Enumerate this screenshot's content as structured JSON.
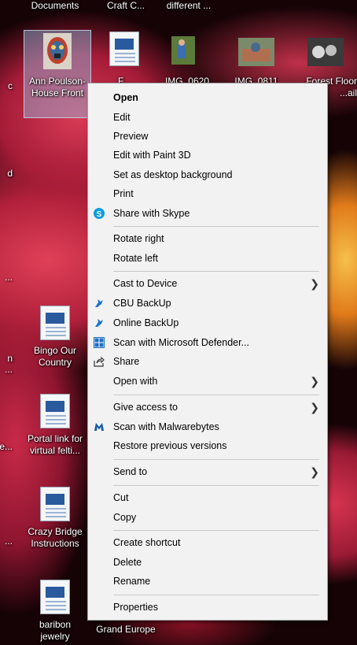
{
  "desktop": {
    "top_labels": [
      "Documents",
      "Craft C...",
      "different ..."
    ],
    "row1": [
      {
        "label": "Ann Poulson-House Front",
        "kind": "image",
        "selected": true
      },
      {
        "label": "F...",
        "kind": "document"
      },
      {
        "label": "IMG_0620",
        "kind": "photo"
      },
      {
        "label": "IMG_0811",
        "kind": "photo"
      },
      {
        "label": "Forest Floor ...ail",
        "kind": "photo"
      }
    ],
    "column_items": [
      {
        "label": "Bingo Our Country",
        "kind": "document"
      },
      {
        "label": "Portal link for virtual felti...",
        "kind": "document"
      },
      {
        "label": "Crazy Bridge Instructions",
        "kind": "document"
      },
      {
        "label": "baribon jewelry",
        "kind": "document"
      }
    ],
    "bottom_label": "Grand Europe",
    "edge_fragments": [
      "c",
      "d",
      "...",
      "n",
      "...",
      "e...",
      "..."
    ]
  },
  "context_menu": {
    "items": [
      {
        "label": "Open",
        "bold": true,
        "icon": null,
        "submenu": false
      },
      {
        "label": "Edit",
        "icon": null,
        "submenu": false
      },
      {
        "label": "Preview",
        "icon": null,
        "submenu": false
      },
      {
        "label": "Edit with Paint 3D",
        "icon": null,
        "submenu": false
      },
      {
        "label": "Set as desktop background",
        "icon": null,
        "submenu": false
      },
      {
        "label": "Print",
        "icon": null,
        "submenu": false
      },
      {
        "label": "Share with Skype",
        "icon": "skype-icon",
        "submenu": false
      },
      {
        "label": "Rotate right",
        "icon": null,
        "submenu": false
      },
      {
        "label": "Rotate left",
        "icon": null,
        "submenu": false
      },
      {
        "label": "Cast to Device",
        "icon": null,
        "submenu": true
      },
      {
        "label": "CBU BackUp",
        "icon": "backup-icon",
        "submenu": false
      },
      {
        "label": "Online BackUp",
        "icon": "backup-icon",
        "submenu": false
      },
      {
        "label": "Scan with Microsoft Defender...",
        "icon": "defender-icon",
        "submenu": false
      },
      {
        "label": "Share",
        "icon": "share-icon",
        "submenu": false
      },
      {
        "label": "Open with",
        "icon": null,
        "submenu": true
      },
      {
        "label": "Give access to",
        "icon": null,
        "submenu": true
      },
      {
        "label": "Scan with Malwarebytes",
        "icon": "malwarebytes-icon",
        "submenu": false
      },
      {
        "label": "Restore previous versions",
        "icon": null,
        "submenu": false
      },
      {
        "label": "Send to",
        "icon": null,
        "submenu": true
      },
      {
        "label": "Cut",
        "icon": null,
        "submenu": false
      },
      {
        "label": "Copy",
        "icon": null,
        "submenu": false
      },
      {
        "label": "Create shortcut",
        "icon": null,
        "submenu": false
      },
      {
        "label": "Delete",
        "icon": null,
        "submenu": false
      },
      {
        "label": "Rename",
        "icon": null,
        "submenu": false
      },
      {
        "label": "Properties",
        "icon": null,
        "submenu": false
      }
    ]
  },
  "colors": {
    "menu_bg": "#f2f2f2",
    "separator": "#c8c8c8",
    "skype_blue": "#0a9ce0",
    "defender_blue": "#1e6fc4",
    "malwarebytes_blue": "#1256a8"
  }
}
